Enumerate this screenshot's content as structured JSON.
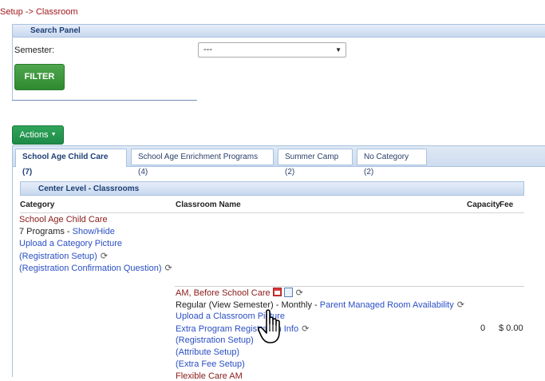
{
  "breadcrumb": "Setup -> Classroom",
  "search_panel": {
    "title": "Search Panel",
    "semester_label": "Semester:",
    "semester_value": "---",
    "filter_label": "FILTER"
  },
  "actions_label": "Actions",
  "tabs": [
    {
      "label": "School Age Child Care (7)",
      "active": true
    },
    {
      "label": "School Age Enrichment Programs (4)",
      "active": false
    },
    {
      "label": "Summer Camp (2)",
      "active": false
    },
    {
      "label": "No Category (2)",
      "active": false
    }
  ],
  "center_level": {
    "title": "Center Level - Classrooms",
    "columns": {
      "category": "Category",
      "classroom_name": "Classroom Name",
      "capacity": "Capacity",
      "fee": "Fee"
    }
  },
  "category": {
    "name": "School Age Child Care",
    "programs_count": "7 Programs",
    "dash": " - ",
    "show_hide": "Show/Hide",
    "upload_picture": "Upload a Category Picture",
    "registration_setup": "(Registration Setup)",
    "registration_confirmation": "(Registration Confirmation Question)"
  },
  "classroom": {
    "name": "AM, Before School Care",
    "regular": "Regular (View Semester)",
    "monthly": " - Monthly - ",
    "parent_managed": "Parent Managed Room Availability",
    "upload_picture": "Upload a Classroom Picture",
    "extra_program": "Extra Program Registration Info",
    "registration_setup": "(Registration Setup)",
    "attribute_setup": "(Attribute Setup)",
    "extra_fee_setup": "(Extra Fee Setup)",
    "capacity": "0",
    "fee": "$ 0.00",
    "next_name": "Flexible Care AM"
  },
  "colors": {
    "breadcrumb": "#a0161b",
    "link": "#2a4fc4",
    "category": "#8b1a1a",
    "filter": "#3a9a3a",
    "actions": "#23975a",
    "panel_header": "#1e3f74"
  }
}
